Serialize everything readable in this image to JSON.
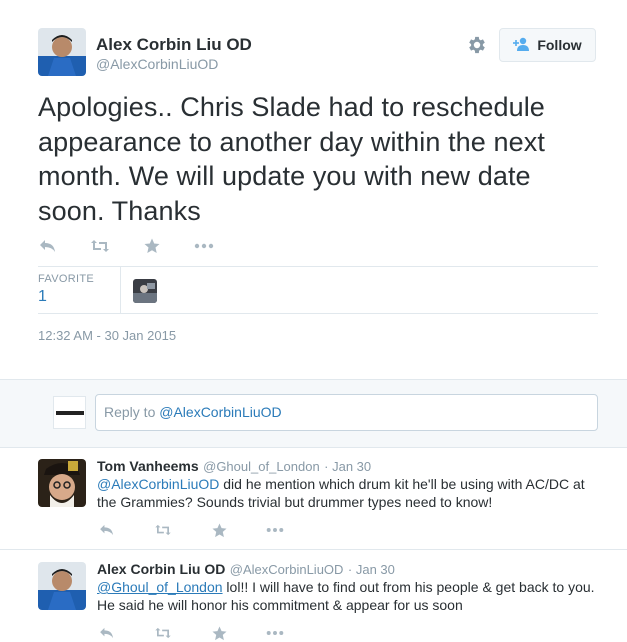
{
  "tweet": {
    "author_name": "Alex Corbin Liu OD",
    "author_handle": "@AlexCorbinLiuOD",
    "follow_label": "Follow",
    "text": "Apologies.. Chris Slade had to reschedule appearance to another day within the next month. We will update you with new date soon. Thanks",
    "favorite_label": "FAVORITE",
    "favorite_count": "1",
    "timestamp": "12:32 AM - 30 Jan 2015",
    "icons": [
      "reply-icon",
      "retweet-icon",
      "favorite-star-icon",
      "more-dots-icon",
      "gear-icon",
      "follow-person-icon"
    ]
  },
  "reply_box": {
    "prefix": "Reply to ",
    "mention": "@AlexCorbinLiuOD"
  },
  "replies": [
    {
      "name": "Tom Vanheems",
      "handle": "@Ghoul_of_London",
      "date": "Jan 30",
      "mention": "@AlexCorbinLiuOD",
      "text": " did he mention which drum kit he'll be using with AC/DC at the Grammies? Sounds trivial but drummer types need to know!"
    },
    {
      "name": "Alex Corbin Liu OD",
      "handle": "@AlexCorbinLiuOD",
      "date": "Jan 30",
      "mention": "@Ghoul_of_London",
      "text": " lol!! I will have to find out from his people & get back to you. He said he will honor his commitment & appear for us soon"
    }
  ],
  "colors": {
    "link": "#2b7bb9",
    "muted": "#8899a6",
    "icon": "#aab8c2",
    "reply_bg": "#f5f8fa"
  }
}
